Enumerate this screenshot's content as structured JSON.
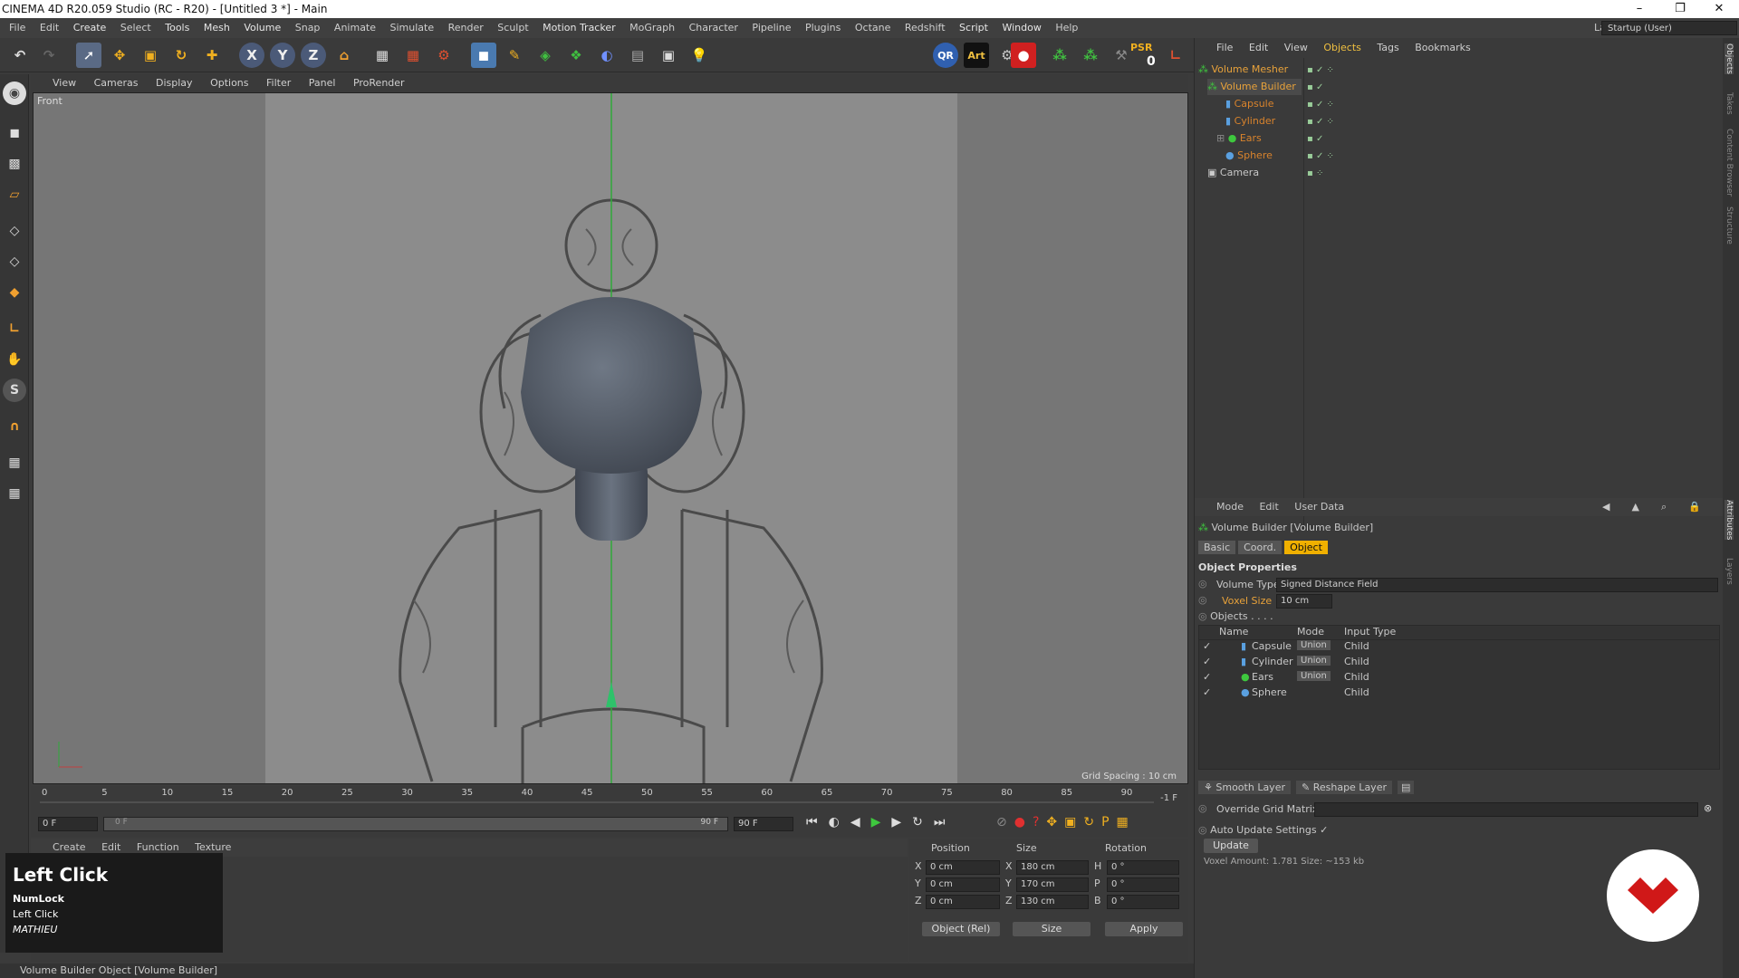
{
  "window": {
    "title": "CINEMA 4D R20.059 Studio (RC - R20) - [Untitled 3 *] - Main",
    "minimize": "–",
    "restore": "❐",
    "close": "✕"
  },
  "menu": [
    "File",
    "Edit",
    "Create",
    "Select",
    "Tools",
    "Mesh",
    "Volume",
    "Snap",
    "Animate",
    "Simulate",
    "Render",
    "Sculpt",
    "Motion Tracker",
    "MoGraph",
    "Character",
    "Pipeline",
    "Plugins",
    "Octane",
    "Redshift",
    "Script",
    "Window",
    "Help"
  ],
  "layout": {
    "label": "Layout:",
    "value": "Startup (User)"
  },
  "toolbar": {
    "psr_label": "PSR",
    "psr_value": "0",
    "qr": "QR",
    "art": "Art"
  },
  "viewport": {
    "menu": [
      "View",
      "Cameras",
      "Display",
      "Options",
      "Filter",
      "Panel",
      "ProRender"
    ],
    "camera_label": "Front",
    "grid_spacing": "Grid Spacing : 10 cm"
  },
  "timeline": {
    "ticks": [
      "0",
      "5",
      "10",
      "15",
      "20",
      "25",
      "30",
      "35",
      "40",
      "45",
      "50",
      "55",
      "60",
      "65",
      "70",
      "75",
      "80",
      "85",
      "90"
    ],
    "end_frame": "-1 F",
    "current_frame": "0 F",
    "range_start": "0 F",
    "range_end": "90 F",
    "max_frame": "90 F"
  },
  "materials": {
    "menu": [
      "Create",
      "Edit",
      "Function",
      "Texture"
    ]
  },
  "coordinates": {
    "headers": {
      "position": "Position",
      "size": "Size",
      "rotation": "Rotation"
    },
    "rows": [
      {
        "axis": "X",
        "pos": "0 cm",
        "saxis": "X",
        "size": "180 cm",
        "raxis": "H",
        "rot": "0 °"
      },
      {
        "axis": "Y",
        "pos": "0 cm",
        "saxis": "Y",
        "size": "170 cm",
        "raxis": "P",
        "rot": "0 °"
      },
      {
        "axis": "Z",
        "pos": "0 cm",
        "saxis": "Z",
        "size": "130 cm",
        "raxis": "B",
        "rot": "0 °"
      }
    ],
    "mode": "Object (Rel)",
    "size_mode": "Size",
    "apply": "Apply"
  },
  "status_bar": "Volume Builder Object [Volume Builder]",
  "osd": {
    "title": "Left Click",
    "line1": "NumLock",
    "line2": "Left Click",
    "line3": "MATHIEU"
  },
  "objects_panel": {
    "menu": [
      "File",
      "Edit",
      "View",
      "Objects",
      "Tags",
      "Bookmarks"
    ],
    "tree": [
      {
        "name": "Volume Mesher",
        "color": "#e8a23a"
      },
      {
        "name": "Volume Builder",
        "color": "#e8a23a"
      },
      {
        "name": "Capsule",
        "color": "#d9832c"
      },
      {
        "name": "Cylinder",
        "color": "#d9832c"
      },
      {
        "name": "Ears",
        "color": "#d9832c"
      },
      {
        "name": "Sphere",
        "color": "#d9832c"
      },
      {
        "name": "Camera",
        "color": "#c8c8c8"
      }
    ]
  },
  "attributes": {
    "menu": [
      "Mode",
      "Edit",
      "User Data"
    ],
    "title": "Volume Builder [Volume Builder]",
    "tabs": [
      "Basic",
      "Coord.",
      "Object"
    ],
    "section": "Object Properties",
    "volume_type_label": "Volume Type",
    "volume_type": "Signed Distance Field",
    "voxel_size_label": "Voxel Size",
    "voxel_size": "10 cm",
    "objects_label": "Objects . . . .",
    "list_headers": [
      "Name",
      "Mode",
      "Input Type"
    ],
    "list": [
      {
        "name": "Capsule",
        "mode": "Union",
        "type": "Child"
      },
      {
        "name": "Cylinder",
        "mode": "Union",
        "type": "Child"
      },
      {
        "name": "Ears",
        "mode": "Union",
        "type": "Child"
      },
      {
        "name": "Sphere",
        "mode": "",
        "type": "Child"
      }
    ],
    "layer_buttons": [
      "Smooth Layer",
      "Reshape Layer"
    ],
    "override_grid": "Override Grid Matrix",
    "auto_update": "Auto Update Settings",
    "update_button": "Update",
    "voxel_info": "Voxel Amount: 1.781   Size: ~153 kb"
  },
  "side_tabs": [
    "Objects",
    "Takes",
    "Content Browser",
    "Structure",
    "Attributes",
    "Layers"
  ]
}
